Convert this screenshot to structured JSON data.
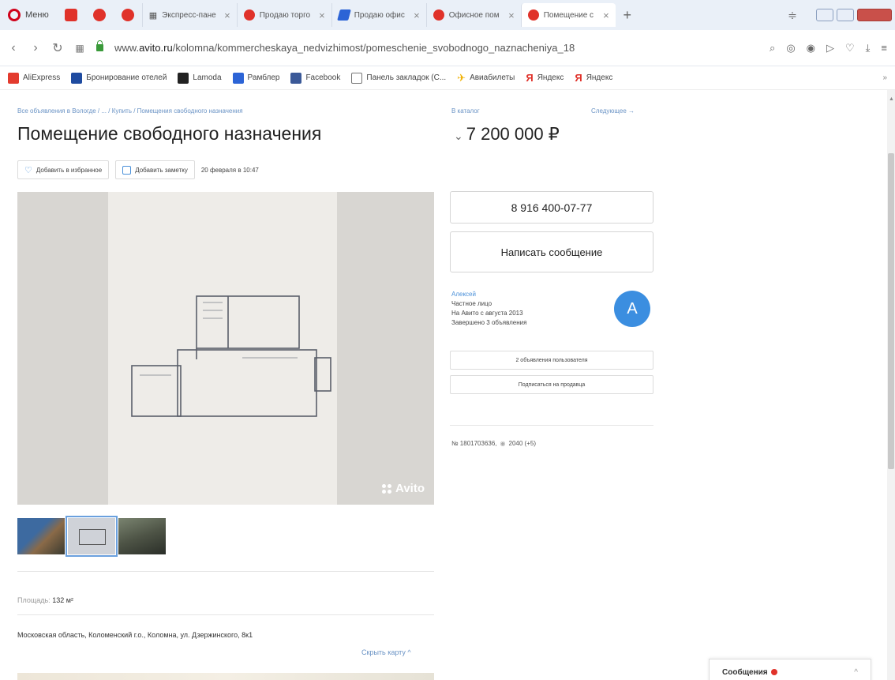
{
  "browser": {
    "menu_label": "Меню",
    "tabs": [
      {
        "label": "Экспресс-пане",
        "icon": "grid-icon"
      },
      {
        "label": "Продаю торго",
        "icon": "opera-icon"
      },
      {
        "label": "Продаю офис",
        "icon": "avito-icon"
      },
      {
        "label": "Офисное пом",
        "icon": "opera-icon"
      },
      {
        "label": "Помещение с",
        "icon": "opera-icon",
        "active": true
      }
    ],
    "new_tab": "+",
    "url_prefix": "www.",
    "url_domain": "avito.ru",
    "url_path": "/kolomna/kommercheskaya_nedvizhimost/pomeschenie_svobodnogo_naznacheniya_18",
    "bookmarks": [
      {
        "label": "AliExpress",
        "color": "#e33b2e"
      },
      {
        "label": "Бронирование отелей",
        "color": "#1f4ba0"
      },
      {
        "label": "Lamoda",
        "color": "#222222"
      },
      {
        "label": "Рамблер",
        "color": "#2c64d6"
      },
      {
        "label": "Facebook",
        "color": "#3b5998"
      },
      {
        "label": "Панель закладок (С...",
        "color": "#ffffff"
      },
      {
        "label": "Авиабилеты",
        "color": "#f0b000"
      },
      {
        "label": "Яндекс",
        "color": "#e0322a"
      },
      {
        "label": "Яндекс",
        "color": "#e0322a"
      }
    ],
    "bookmarks_more": "»"
  },
  "page": {
    "breadcrumbs": "Все объявления в Вологде / ... / Купить / Помещения свободного назначения",
    "to_catalog": "В каталог",
    "next_link": "Следующее →",
    "title": "Помещение свободного назначения",
    "price": "7 200 000 ₽",
    "price_caret": "⌄",
    "add_favorite": "Добавить в избранное",
    "add_note": "Добавить заметку",
    "date": "20 февраля в 10:47",
    "watermark": "Avito",
    "area_label": "Площадь:",
    "area_value": "132 м²",
    "address": "Московская область, Коломенский г.о., Коломна, ул. Дзержинского, 8к1",
    "hide_map": "Скрыть карту ^"
  },
  "sidebar": {
    "phone": "8 916 400-07-77",
    "write_message": "Написать сообщение",
    "seller_name": "Алексей",
    "seller_type": "Частное лицо",
    "seller_since": "На Авито с августа 2013",
    "seller_completed": "Завершено 3 объявления",
    "avatar_letter": "A",
    "seller_ads": "2 объявления пользователя",
    "subscribe": "Подписаться на продавца",
    "ad_number": "№ 1801703636,",
    "views": "2040 (+5)"
  },
  "messages": {
    "label": "Сообщения",
    "caret": "^"
  }
}
